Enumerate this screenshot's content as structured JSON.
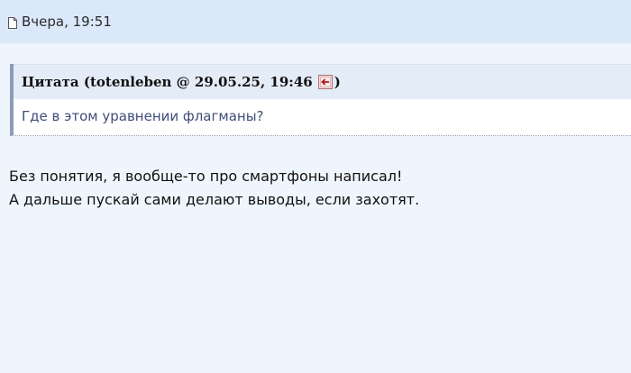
{
  "post": {
    "date": "Вчера, 19:51",
    "date_icon": "document-icon"
  },
  "quote": {
    "title_prefix": "Цитата (totenleben @ 29.05.25, 19:46",
    "title_suffix": ")",
    "back_icon": "go-to-post-icon",
    "text": "Где в этом уравнении флагманы?"
  },
  "message": {
    "lines": [
      "Без понятия, я вообще-то про смартфоны написал!",
      "А дальше пускай сами делают выводы, если захотят."
    ]
  },
  "colors": {
    "header_bg": "#dbe8fa",
    "page_bg": "#eff5fd",
    "quote_border": "#8a9cb9",
    "quote_text": "#3e4e79"
  }
}
